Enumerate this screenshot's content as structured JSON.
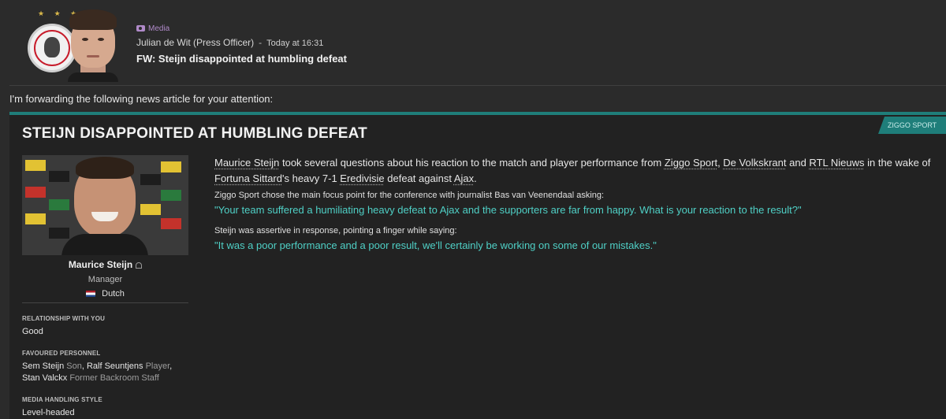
{
  "header": {
    "club_badge_icon": "ajax-crest-icon",
    "club_badge_stars": "★ ★ ★",
    "press_officer_avatar_icon": "person-avatar-icon",
    "media_tag": "Media",
    "media_icon": "media-icon",
    "sender": "Julian de Wit (Press Officer)",
    "separator": "-",
    "timestamp": "Today at 16:31",
    "subject": "FW: Steijn disappointed at humbling defeat"
  },
  "forward_text": "I'm forwarding the following news article for your attention:",
  "article": {
    "source_badge": "ZIGGO SPORT",
    "headline": "STEIJN DISAPPOINTED AT HUMBLING DEFEAT",
    "intro": {
      "p1": "Maurice Steijn",
      "p2": " took several questions about his reaction to the match and player performance from ",
      "p3": "Ziggo Sport",
      "p4": ", ",
      "p5": "De Volkskrant",
      "p6": " and ",
      "p7": "RTL Nieuws",
      "p8": " in the wake of ",
      "p9": "Fortuna Sittard",
      "p10": "'s heavy 7-1 ",
      "p11": "Eredivisie",
      "p12": " defeat against ",
      "p13": "Ajax",
      "p14": "."
    },
    "focus_text": "Ziggo Sport chose the main focus point for the conference with journalist Bas van Veenendaal asking:",
    "question": "\"Your team suffered a humiliating heavy defeat to Ajax and the supporters are far from happy. What is your reaction to the result?\"",
    "response_text": "Steijn was assertive in response, pointing a finger while saying:",
    "answer": "\"It was a poor performance and a poor result, we'll certainly be working on some of our mistakes.\""
  },
  "profile": {
    "name": "Maurice Steijn",
    "role": "Manager",
    "nationality": "Dutch",
    "relationship_label": "RELATIONSHIP WITH YOU",
    "relationship_value": "Good",
    "favoured_label": "FAVOURED PERSONNEL",
    "favoured": {
      "n1": "Sem Steijn",
      "r1": " Son",
      "c1": ", ",
      "n2": "Ralf Seuntjens",
      "r2": " Player",
      "c2": ",",
      "n3": "Stan Valckx",
      "r3": " Former Backroom Staff"
    },
    "media_label": "MEDIA HANDLING STYLE",
    "media_value": "Level-headed"
  },
  "colors": {
    "accent_teal": "#1f7e7a",
    "quote_teal": "#4fd0c6",
    "media_purple": "#b08ac9",
    "background": "#2b2b2b"
  }
}
